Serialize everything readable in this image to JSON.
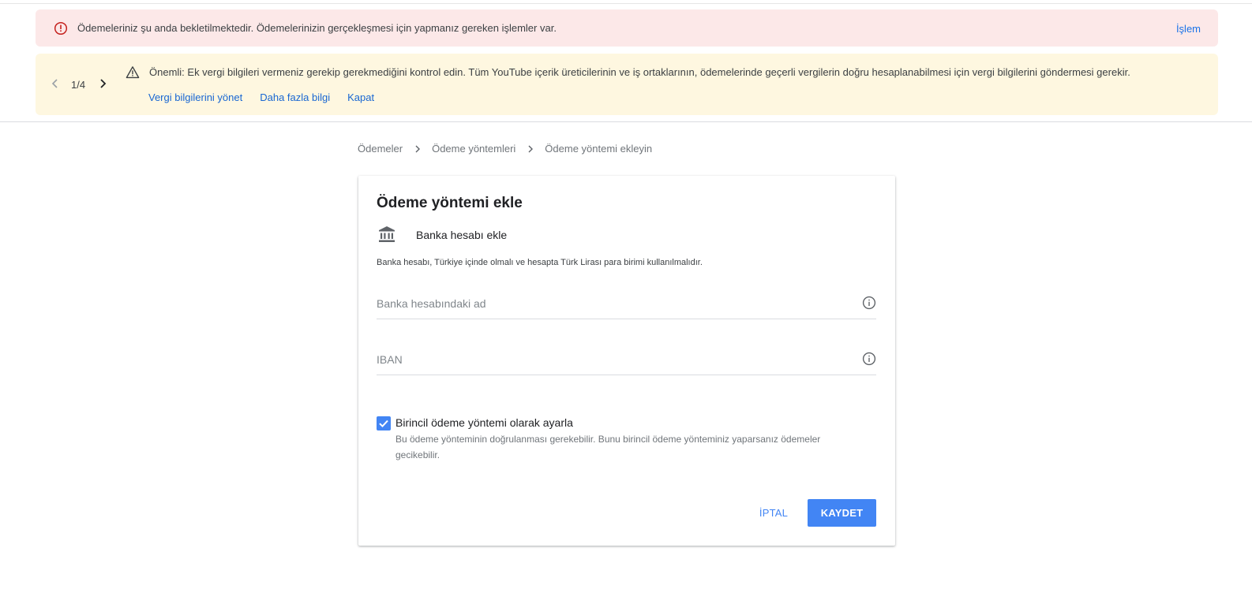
{
  "alerts": {
    "error": {
      "icon": "error-circle-icon",
      "message": "Ödemeleriniz şu anda bekletilmektedir. Ödemelerinizin gerçekleşmesi için yapmanız gereken işlemler var.",
      "action_label": "İşlem",
      "color": "#c5221f"
    },
    "warning": {
      "pager": "1/4",
      "icon": "warning-triangle-icon",
      "message": "Önemli: Ek vergi bilgileri vermeniz gerekip gerekmediğini kontrol edin. Tüm YouTube içerik üreticilerinin ve iş ortaklarının, ödemelerinde geçerli vergilerin doğru hesaplanabilmesi için vergi bilgilerini göndermesi gerekir.",
      "links": [
        "Vergi bilgilerini yönet",
        "Daha fazla bilgi",
        "Kapat"
      ]
    }
  },
  "breadcrumb": [
    "Ödemeler",
    "Ödeme yöntemleri",
    "Ödeme yöntemi ekleyin"
  ],
  "card": {
    "title": "Ödeme yöntemi ekle",
    "bank_icon": "bank-icon",
    "bank_label": "Banka hesabı ekle",
    "note": "Banka hesabı, Türkiye içinde olmalı ve hesapta Türk Lirası para birimi kullanılmalıdır.",
    "fields": {
      "account_name": {
        "value": "",
        "placeholder": "Banka hesabındaki ad"
      },
      "iban": {
        "value": "",
        "placeholder": "IBAN"
      }
    },
    "primary_checkbox": {
      "checked": true,
      "label": "Birincil ödeme yöntemi olarak ayarla",
      "help": "Bu ödeme yönteminin doğrulanması gerekebilir. Bunu birincil ödeme yönteminiz yaparsanız ödemeler gecikebilir."
    },
    "buttons": {
      "cancel": "İPTAL",
      "save": "KAYDET"
    }
  },
  "colors": {
    "accent": "#4285f4",
    "error_bg": "#fce8e8",
    "warning_bg": "#fef7e0"
  }
}
